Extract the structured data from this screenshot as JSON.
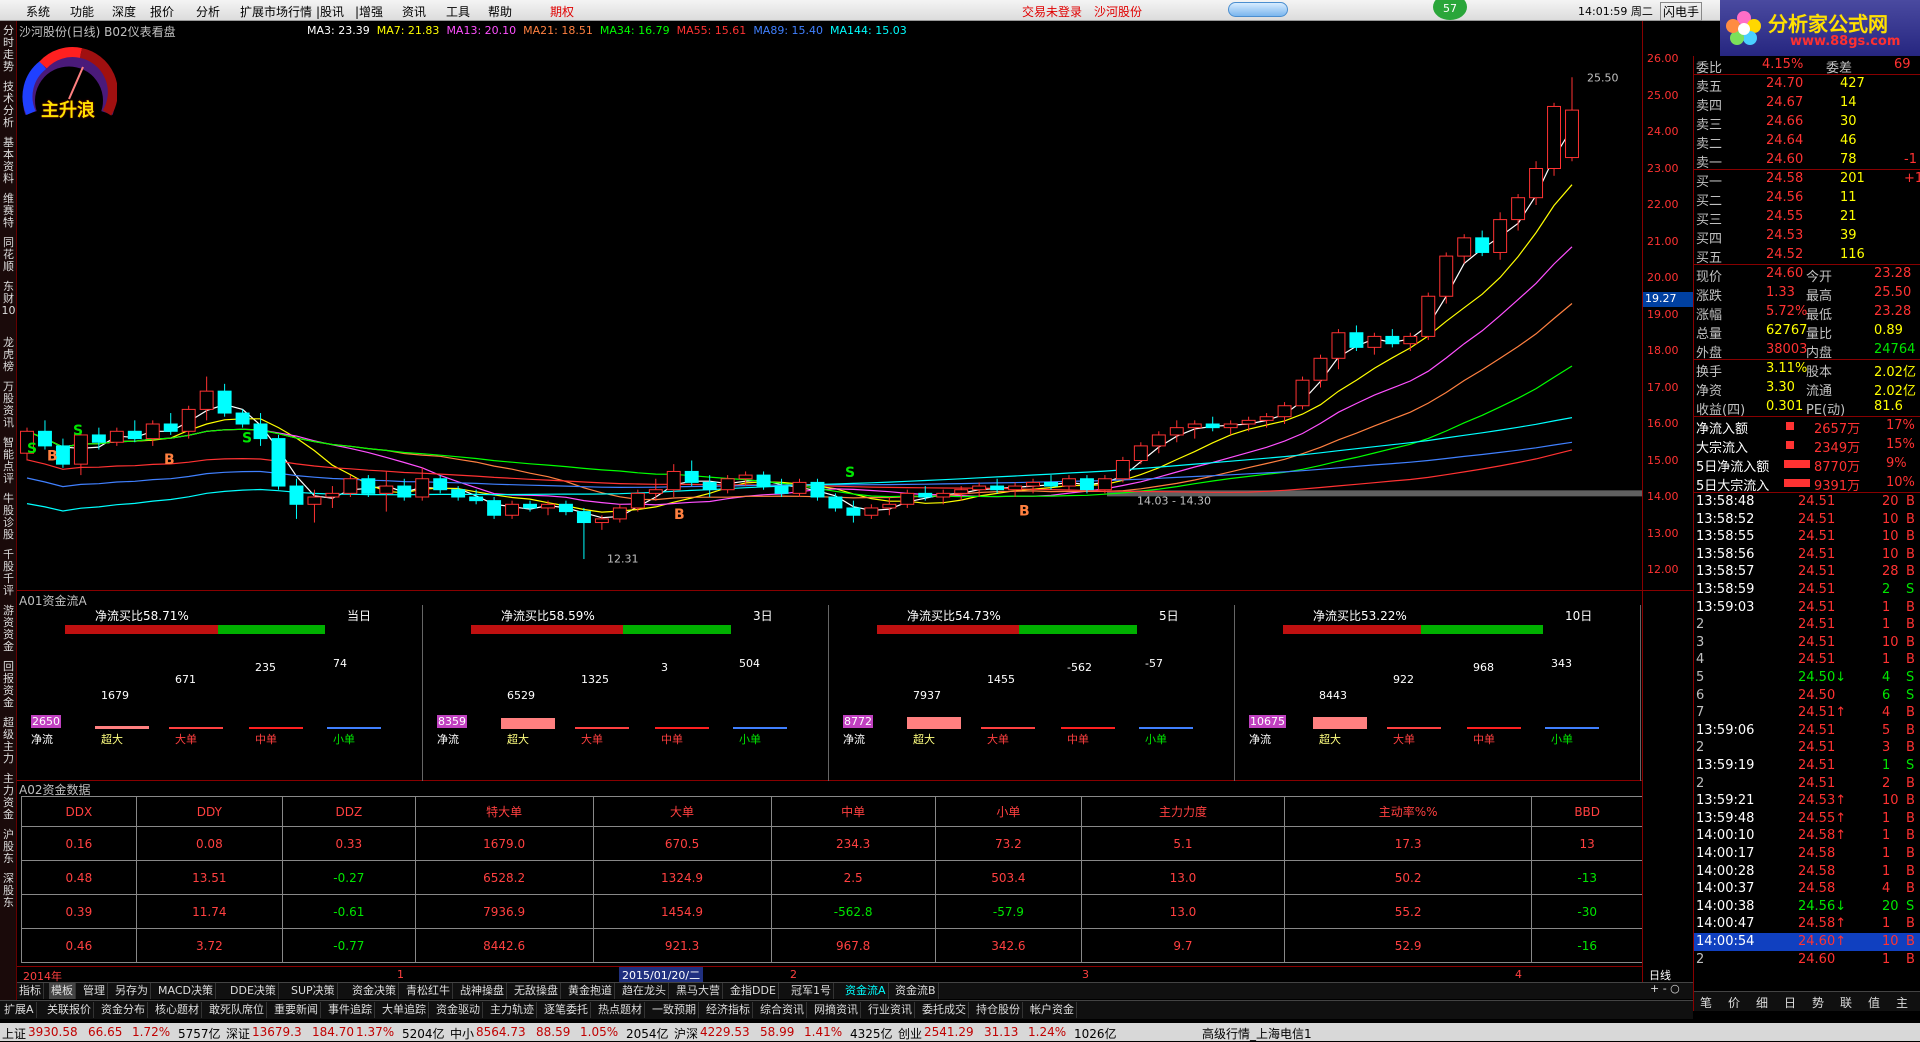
{
  "menu": {
    "items": [
      "系统",
      "功能",
      "深度",
      "报价",
      "分析",
      "扩展市场行情",
      "|股讯",
      "|增强",
      "资讯",
      "工具",
      "帮助",
      "期权"
    ],
    "login_status": "交易未登录",
    "stock_name": "沙河股份",
    "badge": "57",
    "clock": "14:01:59 周二",
    "flash": "闪电手",
    "brand": "分析家公式网",
    "brand_url": "www.88gs.com"
  },
  "left_tabs": [
    "分时走势",
    "技术分析",
    "基本资料",
    "维赛特",
    "同花顺",
    "东财10",
    "龙虎榜",
    "万股资讯",
    "智能点评",
    "牛股诊股",
    "千股千评",
    "游资资金",
    "回报资金",
    "超级主力",
    "主力资金",
    "沪股东",
    "深股东"
  ],
  "chart": {
    "title": "沙河股份(日线) B02仪表看盘",
    "gauge_label": "主升浪",
    "ma": [
      {
        "label": "MA3: 23.39",
        "color": "#ffffff"
      },
      {
        "label": "MA7: 21.83",
        "color": "#ffff00"
      },
      {
        "label": "MA13: 20.10",
        "color": "#ff50ff"
      },
      {
        "label": "MA21: 18.51",
        "color": "#ff8040"
      },
      {
        "label": "MA34: 16.79",
        "color": "#00ff00"
      },
      {
        "label": "MA55: 15.61",
        "color": "#ff3232"
      },
      {
        "label": "MA89: 15.40",
        "color": "#4080ff"
      },
      {
        "label": "MA144: 15.03",
        "color": "#00ffff"
      }
    ],
    "y_ticks": [
      "26.00",
      "25.00",
      "24.00",
      "23.00",
      "22.00",
      "21.00",
      "20.00",
      "19.00",
      "18.00",
      "17.00",
      "16.00",
      "15.00",
      "14.00",
      "13.00",
      "12.00"
    ],
    "cursor_price": "19.27",
    "annot_high": "25.50",
    "annot_low": "12.31",
    "annot_range": "14.03 - 14.30"
  },
  "chart_data": {
    "type": "candlestick",
    "y_range": [
      11.7,
      26.5
    ],
    "candles": [
      [
        15.2,
        15.9,
        15.0,
        15.8
      ],
      [
        15.8,
        16.1,
        15.3,
        15.4
      ],
      [
        15.4,
        15.6,
        14.8,
        14.9
      ],
      [
        14.9,
        15.8,
        14.6,
        15.7
      ],
      [
        15.7,
        15.9,
        15.3,
        15.5
      ],
      [
        15.5,
        15.9,
        15.4,
        15.8
      ],
      [
        15.8,
        16.1,
        15.5,
        15.6
      ],
      [
        15.6,
        16.1,
        15.4,
        16.0
      ],
      [
        16.0,
        16.3,
        15.7,
        15.8
      ],
      [
        15.8,
        16.5,
        15.6,
        16.4
      ],
      [
        16.4,
        17.3,
        16.1,
        16.9
      ],
      [
        16.9,
        17.1,
        16.2,
        16.3
      ],
      [
        16.3,
        16.4,
        15.9,
        16.0
      ],
      [
        16.0,
        16.3,
        15.4,
        15.6
      ],
      [
        15.6,
        15.7,
        14.2,
        14.3
      ],
      [
        14.3,
        14.5,
        13.4,
        13.8
      ],
      [
        13.8,
        14.2,
        13.3,
        14.0
      ],
      [
        14.0,
        14.3,
        13.7,
        14.1
      ],
      [
        14.1,
        14.6,
        14.0,
        14.5
      ],
      [
        14.5,
        14.6,
        14.0,
        14.1
      ],
      [
        14.1,
        14.7,
        13.6,
        14.3
      ],
      [
        14.3,
        14.5,
        13.9,
        14.0
      ],
      [
        14.0,
        14.8,
        13.9,
        14.5
      ],
      [
        14.5,
        14.6,
        14.1,
        14.2
      ],
      [
        14.2,
        14.3,
        13.9,
        14.0
      ],
      [
        14.0,
        14.2,
        13.8,
        13.9
      ],
      [
        13.9,
        14.0,
        13.4,
        13.5
      ],
      [
        13.5,
        13.9,
        13.4,
        13.8
      ],
      [
        13.8,
        13.9,
        13.6,
        13.7
      ],
      [
        13.7,
        13.9,
        13.5,
        13.8
      ],
      [
        13.8,
        13.9,
        13.5,
        13.6
      ],
      [
        13.6,
        13.7,
        12.3,
        13.3
      ],
      [
        13.3,
        13.5,
        13.1,
        13.4
      ],
      [
        13.4,
        13.8,
        13.3,
        13.7
      ],
      [
        13.7,
        14.2,
        13.6,
        14.1
      ],
      [
        14.1,
        14.5,
        13.9,
        14.2
      ],
      [
        14.2,
        14.9,
        14.0,
        14.7
      ],
      [
        14.7,
        15.0,
        14.3,
        14.4
      ],
      [
        14.4,
        14.6,
        14.0,
        14.2
      ],
      [
        14.2,
        14.6,
        14.1,
        14.5
      ],
      [
        14.5,
        14.7,
        14.3,
        14.6
      ],
      [
        14.6,
        14.7,
        14.2,
        14.3
      ],
      [
        14.3,
        14.5,
        14.0,
        14.1
      ],
      [
        14.1,
        14.5,
        14.0,
        14.4
      ],
      [
        14.4,
        14.5,
        13.9,
        14.0
      ],
      [
        14.0,
        14.1,
        13.6,
        13.7
      ],
      [
        13.7,
        13.9,
        13.3,
        13.5
      ],
      [
        13.5,
        13.8,
        13.4,
        13.7
      ],
      [
        13.7,
        14.0,
        13.5,
        13.8
      ],
      [
        13.8,
        14.2,
        13.7,
        14.1
      ],
      [
        14.1,
        14.3,
        13.9,
        14.0
      ],
      [
        14.0,
        14.2,
        13.8,
        14.1
      ],
      [
        14.1,
        14.3,
        13.9,
        14.2
      ],
      [
        14.2,
        14.4,
        14.0,
        14.3
      ],
      [
        14.3,
        14.5,
        14.1,
        14.2
      ],
      [
        14.2,
        14.4,
        14.0,
        14.3
      ],
      [
        14.3,
        14.5,
        14.1,
        14.4
      ],
      [
        14.4,
        14.6,
        14.2,
        14.3
      ],
      [
        14.3,
        14.6,
        14.2,
        14.5
      ],
      [
        14.5,
        14.6,
        14.1,
        14.2
      ],
      [
        14.2,
        14.6,
        14.1,
        14.5
      ],
      [
        14.5,
        15.1,
        14.4,
        15.0
      ],
      [
        15.0,
        15.5,
        14.9,
        15.4
      ],
      [
        15.4,
        15.8,
        15.2,
        15.7
      ],
      [
        15.7,
        16.1,
        15.5,
        15.9
      ],
      [
        15.9,
        16.1,
        15.6,
        16.0
      ],
      [
        16.0,
        16.2,
        15.8,
        15.9
      ],
      [
        15.9,
        16.1,
        15.7,
        16.0
      ],
      [
        16.0,
        16.2,
        15.8,
        16.1
      ],
      [
        16.1,
        16.3,
        15.9,
        16.2
      ],
      [
        16.2,
        16.6,
        16.0,
        16.5
      ],
      [
        16.5,
        17.3,
        16.4,
        17.2
      ],
      [
        17.2,
        17.9,
        17.0,
        17.8
      ],
      [
        17.8,
        18.6,
        17.5,
        18.5
      ],
      [
        18.5,
        18.7,
        18.0,
        18.1
      ],
      [
        18.1,
        18.5,
        17.9,
        18.4
      ],
      [
        18.4,
        18.6,
        18.1,
        18.2
      ],
      [
        18.2,
        18.5,
        18.0,
        18.4
      ],
      [
        18.4,
        19.6,
        18.3,
        19.5
      ],
      [
        19.5,
        20.7,
        19.3,
        20.6
      ],
      [
        20.6,
        21.2,
        20.4,
        21.1
      ],
      [
        21.1,
        21.3,
        20.6,
        20.7
      ],
      [
        20.7,
        21.8,
        20.5,
        21.6
      ],
      [
        21.6,
        22.3,
        21.3,
        22.2
      ],
      [
        22.2,
        23.2,
        22.0,
        23.0
      ],
      [
        23.0,
        24.8,
        22.8,
        24.7
      ],
      [
        23.3,
        25.5,
        23.2,
        24.6
      ]
    ]
  },
  "panelA": {
    "title": "A01资金流A",
    "blocks": [
      {
        "ratio": "净流买比58.71%",
        "period": "当日",
        "vals": [
          "2650",
          "1679",
          "671",
          "235",
          "74"
        ]
      },
      {
        "ratio": "净流买比58.59%",
        "period": "3日",
        "vals": [
          "8359",
          "6529",
          "1325",
          "3",
          "504"
        ]
      },
      {
        "ratio": "净流买比54.73%",
        "period": "5日",
        "vals": [
          "8772",
          "7937",
          "1455",
          "-562",
          "-57"
        ]
      },
      {
        "ratio": "净流买比53.22%",
        "period": "10日",
        "vals": [
          "10675",
          "8443",
          "922",
          "968",
          "343"
        ]
      }
    ],
    "cats": [
      "净流",
      "超大",
      "大单",
      "中单",
      "小单"
    ]
  },
  "panelB": {
    "title": "A02资金数据",
    "headers": [
      "DDX",
      "DDY",
      "DDZ",
      "特大单",
      "大单",
      "中单",
      "小单",
      "主力力度",
      "主动率%%",
      "BBD"
    ],
    "rows": [
      [
        "0.16",
        "0.08",
        "0.33",
        "1679.0",
        "670.5",
        "234.3",
        "73.2",
        "5.1",
        "17.3",
        "13"
      ],
      [
        "0.48",
        "13.51",
        "-0.27",
        "6528.2",
        "1324.9",
        "2.5",
        "503.4",
        "13.0",
        "50.2",
        "-13"
      ],
      [
        "0.39",
        "11.74",
        "-0.61",
        "7936.9",
        "1454.9",
        "-562.8",
        "-57.9",
        "13.0",
        "55.2",
        "-30"
      ],
      [
        "0.46",
        "3.72",
        "-0.77",
        "8442.6",
        "921.3",
        "967.8",
        "342.6",
        "9.7",
        "52.9",
        "-16"
      ]
    ]
  },
  "timeline": {
    "year": "2014年",
    "date": "2015/01/20/二",
    "marks": [
      "1",
      "2",
      "3",
      "4"
    ],
    "period": "日线"
  },
  "bottom_tabs1": [
    "指标",
    "模板",
    "管理",
    "另存为",
    "MACD决策",
    "DDE决策",
    "SUP决策",
    "资金决策",
    "青松红牛",
    "战神操盘",
    "无敌操盘",
    "黄金抱道",
    "趋在龙头",
    "黑马大营",
    "金指DDE",
    "冠军1号",
    "资金流A",
    "资金流B"
  ],
  "bottom_tabs2": [
    "扩展A",
    "关联报价",
    "资金分布",
    "核心题材",
    "敢死队席位",
    "重要新闻",
    "事件追踪",
    "大单追踪",
    "资金驱动",
    "主力轨迹",
    "逐笔委托",
    "热点题材",
    "一致预期",
    "经济指标",
    "综合资讯",
    "网摘资讯",
    "行业资讯",
    "委托成交",
    "持仓股份",
    "帐户资金"
  ],
  "right": {
    "weibi": [
      "委比",
      "4.15%",
      "委差",
      "69"
    ],
    "sells": [
      [
        "卖五",
        "24.70",
        "427",
        ""
      ],
      [
        "卖四",
        "24.67",
        "14",
        ""
      ],
      [
        "卖三",
        "24.66",
        "30",
        ""
      ],
      [
        "卖二",
        "24.64",
        "46",
        ""
      ],
      [
        "卖一",
        "24.60",
        "78",
        "-1"
      ]
    ],
    "buys": [
      [
        "买一",
        "24.58",
        "201",
        "+1"
      ],
      [
        "买二",
        "24.56",
        "11",
        ""
      ],
      [
        "买三",
        "24.55",
        "21",
        ""
      ],
      [
        "买四",
        "24.53",
        "39",
        ""
      ],
      [
        "买五",
        "24.52",
        "116",
        ""
      ]
    ],
    "quote": [
      [
        "现价",
        "24.60",
        "今开",
        "23.28"
      ],
      [
        "涨跌",
        "1.33",
        "最高",
        "25.50"
      ],
      [
        "涨幅",
        "5.72%",
        "最低",
        "23.28"
      ],
      [
        "总量",
        "62767",
        "量比",
        "0.89"
      ],
      [
        "外盘",
        "38003",
        "内盘",
        "24764"
      ],
      [
        "换手",
        "3.11%",
        "股本",
        "2.02亿"
      ],
      [
        "净资",
        "3.30",
        "流通",
        "2.02亿"
      ],
      [
        "收益(四)",
        "0.301",
        "PE(动)",
        "81.6"
      ]
    ],
    "flows": [
      [
        "净流入额",
        "2657万",
        "17%"
      ],
      [
        "大宗流入",
        "2349万",
        "15%"
      ],
      [
        "5日净流入额",
        "8770万",
        "9%"
      ],
      [
        "5日大宗流入",
        "9391万",
        "10%"
      ]
    ],
    "ticks": [
      [
        "13:58:48",
        "24.51",
        "20",
        "B"
      ],
      [
        "13:58:52",
        "24.51",
        "10",
        "B"
      ],
      [
        "13:58:55",
        "24.51",
        "10",
        "B"
      ],
      [
        "13:58:56",
        "24.51",
        "10",
        "B"
      ],
      [
        "13:58:57",
        "24.51",
        "28",
        "B"
      ],
      [
        "13:58:59",
        "24.51",
        "2",
        "S"
      ],
      [
        "13:59:03",
        "24.51",
        "1",
        "B"
      ],
      [
        "2",
        "24.51",
        "1",
        "B"
      ],
      [
        "3",
        "24.51",
        "10",
        "B"
      ],
      [
        "4",
        "24.51",
        "1",
        "B"
      ],
      [
        "5",
        "24.50↓",
        "4",
        "S"
      ],
      [
        "6",
        "24.50",
        "6",
        "S"
      ],
      [
        "7",
        "24.51↑",
        "4",
        "B"
      ],
      [
        "13:59:06",
        "24.51",
        "5",
        "B"
      ],
      [
        "2",
        "24.51",
        "3",
        "B"
      ],
      [
        "13:59:19",
        "24.51",
        "1",
        "S"
      ],
      [
        "2",
        "24.51",
        "2",
        "B"
      ],
      [
        "13:59:21",
        "24.53↑",
        "10",
        "B"
      ],
      [
        "13:59:48",
        "24.55↑",
        "1",
        "B"
      ],
      [
        "14:00:10",
        "24.58↑",
        "1",
        "B"
      ],
      [
        "14:00:17",
        "24.58",
        "1",
        "B"
      ],
      [
        "14:00:28",
        "24.58",
        "1",
        "B"
      ],
      [
        "14:00:37",
        "24.58",
        "4",
        "B"
      ],
      [
        "14:00:38",
        "24.56↓",
        "20",
        "S"
      ],
      [
        "14:00:47",
        "24.58↑",
        "1",
        "B"
      ],
      [
        "14:00:54",
        "24.60↑",
        "10",
        "B"
      ],
      [
        "2",
        "24.60",
        "1",
        "B"
      ]
    ],
    "bottom_tabs": [
      "笔",
      "价",
      "细",
      "日",
      "势",
      "联",
      "值",
      "主"
    ]
  },
  "status": [
    [
      "上证",
      "3930.58",
      "66.65",
      "1.72%",
      "5757亿"
    ],
    [
      "深证",
      "13679.3",
      "184.70",
      "1.37%",
      "5204亿"
    ],
    [
      "中小",
      "8564.73",
      "88.59",
      "1.05%",
      "2054亿"
    ],
    [
      "沪深",
      "4229.53",
      "58.99",
      "1.41%",
      "4325亿"
    ],
    [
      "创业",
      "2541.29",
      "31.13",
      "1.24%",
      "1026亿"
    ]
  ],
  "status_server": "高级行情_上海电信1"
}
